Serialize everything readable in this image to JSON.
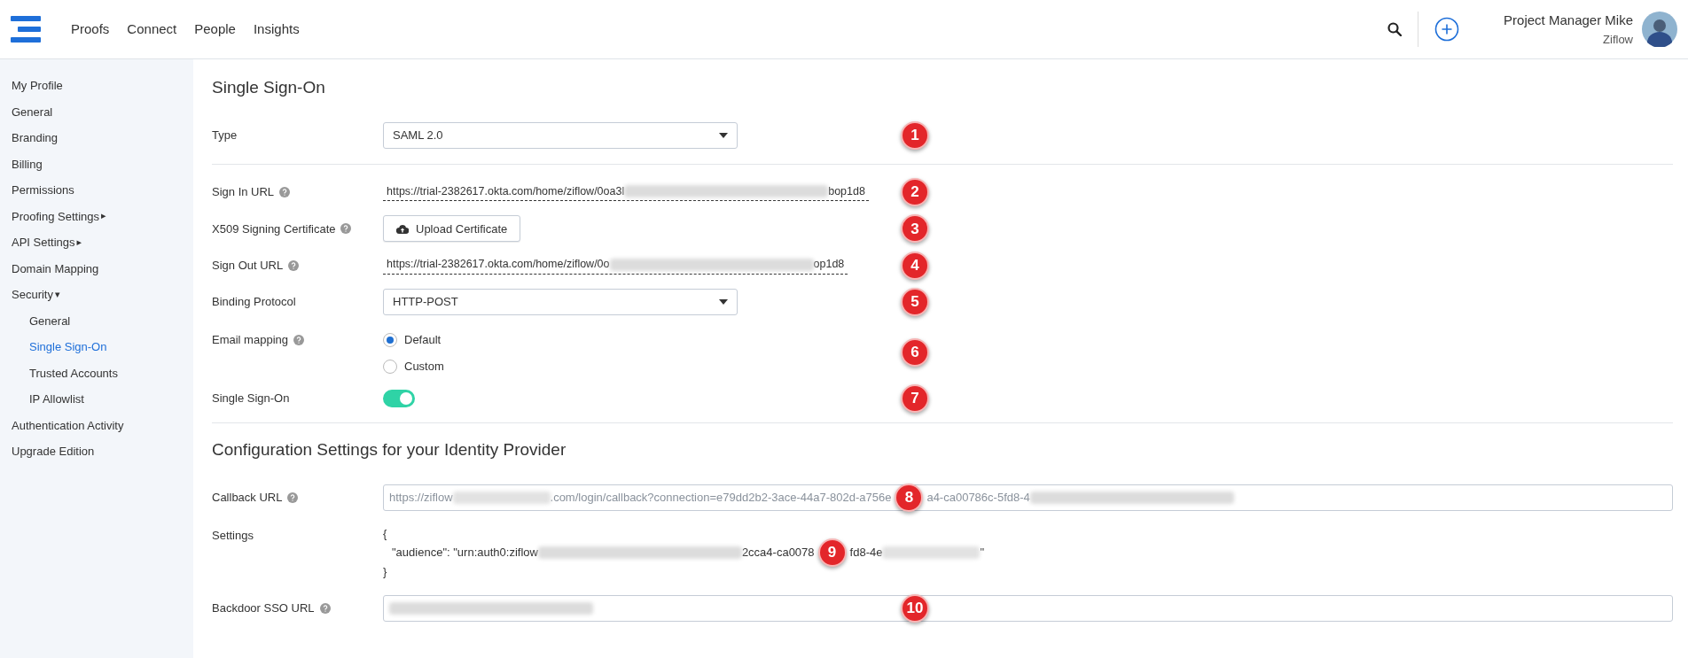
{
  "nav": {
    "links": [
      "Proofs",
      "Connect",
      "People",
      "Insights"
    ]
  },
  "user": {
    "name": "Project Manager Mike",
    "org": "Ziflow"
  },
  "sidebar": {
    "items": [
      {
        "label": "My Profile",
        "selected": false
      },
      {
        "label": "General",
        "selected": false
      },
      {
        "label": "Branding",
        "selected": false
      },
      {
        "label": "Billing",
        "selected": false
      },
      {
        "label": "Permissions",
        "selected": false
      },
      {
        "label": "Proofing Settings",
        "selected": false,
        "caret": "▸"
      },
      {
        "label": "API Settings",
        "selected": false,
        "caret": "▸"
      },
      {
        "label": "Domain Mapping",
        "selected": false
      },
      {
        "label": "Security",
        "selected": false,
        "caret": "▾",
        "children": [
          {
            "label": "General",
            "selected": false
          },
          {
            "label": "Single Sign-On",
            "selected": true
          },
          {
            "label": "Trusted Accounts",
            "selected": false
          },
          {
            "label": "IP Allowlist",
            "selected": false
          }
        ]
      },
      {
        "label": "Authentication Activity",
        "selected": false
      },
      {
        "label": "Upgrade Edition",
        "selected": false
      }
    ]
  },
  "sections": [
    {
      "title": "Single Sign-On",
      "groups": [
        [
          {
            "kind": "select",
            "label": "Type",
            "value": "SAML 2.0",
            "callout": "1"
          }
        ],
        [
          {
            "kind": "link",
            "label": "Sign In URL",
            "help": true,
            "callout": "2",
            "segments": [
              {
                "kind": "text",
                "text": "https://trial-2382617.okta.com/home/ziflow/0oa3l"
              },
              {
                "kind": "blur"
              },
              {
                "kind": "text",
                "text": "bop1d8"
              }
            ]
          },
          {
            "kind": "upload",
            "label": "X509 Signing Certificate",
            "help": true,
            "value": "Upload Certificate",
            "callout": "3"
          },
          {
            "kind": "link",
            "label": "Sign Out URL",
            "help": true,
            "callout": "4",
            "segments": [
              {
                "kind": "text",
                "text": "https://trial-2382617.okta.com/home/ziflow/0o"
              },
              {
                "kind": "blur"
              },
              {
                "kind": "text",
                "text": "op1d8"
              }
            ]
          },
          {
            "kind": "select",
            "label": "Binding Protocol",
            "value": "HTTP-POST",
            "callout": "5"
          },
          {
            "kind": "radio",
            "label": "Email mapping",
            "help": true,
            "callout": "6",
            "options": [
              {
                "label": "Default",
                "selected": true
              },
              {
                "label": "Custom",
                "selected": false
              }
            ]
          },
          {
            "kind": "toggle",
            "label": "Single Sign-On",
            "on": true,
            "callout": "7"
          }
        ]
      ]
    },
    {
      "title": "Configuration Settings for your Identity Provider",
      "groups": [
        [
          {
            "kind": "input",
            "label": "Callback URL",
            "help": true,
            "segments": [
              {
                "kind": "text",
                "text": "https://ziflow"
              },
              {
                "kind": "smudge"
              },
              {
                "kind": "text",
                "text": ".com/login/callback?connection=e79dd2b2-3ace-44a7-802d-a756e"
              },
              {
                "kind": "callout",
                "text": "8"
              },
              {
                "kind": "text",
                "text": "a4-ca00786c-5fd8-4"
              },
              {
                "kind": "blur"
              }
            ]
          },
          {
            "kind": "code",
            "label": "Settings",
            "open": "{",
            "close": "}",
            "segments": [
              {
                "kind": "text",
                "text": "\"audience\": \"urn:auth0:ziflow"
              },
              {
                "kind": "blur"
              },
              {
                "kind": "text",
                "text": "2cca4-ca0078"
              },
              {
                "kind": "callout",
                "text": "9"
              },
              {
                "kind": "text",
                "text": "fd8-4e"
              },
              {
                "kind": "smudge"
              },
              {
                "kind": "text",
                "text": "\""
              }
            ]
          },
          {
            "kind": "input",
            "label": "Backdoor SSO URL",
            "help": true,
            "callout": "10",
            "segments": [
              {
                "kind": "blur"
              }
            ]
          }
        ]
      ]
    }
  ]
}
